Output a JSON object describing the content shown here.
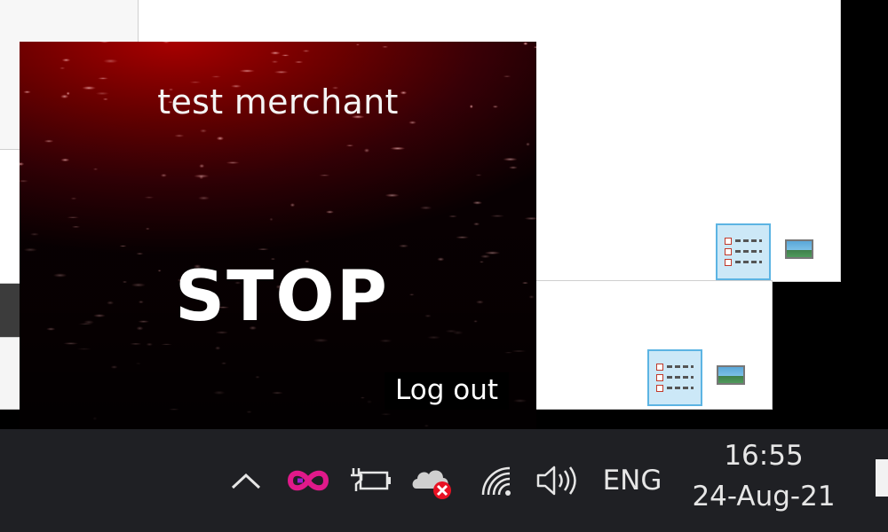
{
  "popup": {
    "merchant_name": "test merchant",
    "action_label": "STOP",
    "logout_label": "Log out"
  },
  "taskbar": {
    "tray_icons": [
      {
        "name": "chevron-up-icon"
      },
      {
        "name": "infinity-app-icon"
      },
      {
        "name": "battery-plug-icon"
      },
      {
        "name": "onedrive-error-icon"
      },
      {
        "name": "wifi-icon"
      },
      {
        "name": "volume-icon"
      }
    ],
    "language": "ENG",
    "time": "16:55",
    "date": "24-Aug-21"
  },
  "colors": {
    "popup_dark": "#0a0002",
    "popup_red": "#a80000",
    "taskbar": "#1f2024",
    "app_icon_magenta": "#e0198a",
    "view_button_highlight": "#cce8f7",
    "error_badge": "#e81123"
  }
}
